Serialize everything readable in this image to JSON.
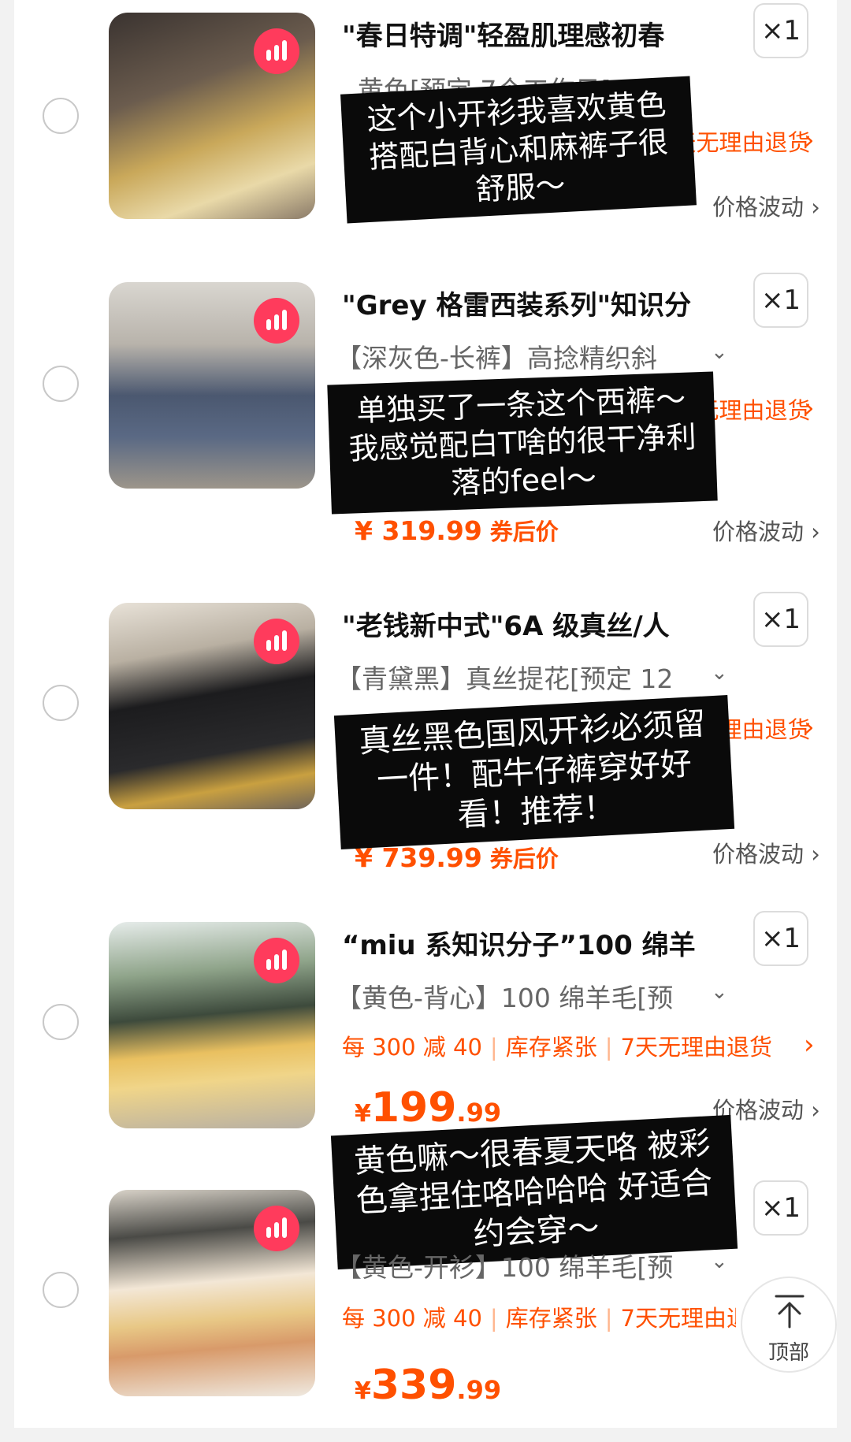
{
  "items": [
    {
      "title": "\"春日特调\"轻盈肌理感初春",
      "sku": "黄色[预定 7个工作日]:S...",
      "tags": [
        "",
        "",
        "7天无理由退货"
      ],
      "price": {
        "display": "",
        "label": ""
      },
      "fluct": "价格波动",
      "qty": "×1",
      "caption": "这个小开衫我喜欢黄色 搭配白背心和麻裤子很舒服～"
    },
    {
      "title": "\"Grey 格雷西装系列\"知识分",
      "sku": "【深灰色-长裤】高捻精织斜",
      "tags": [
        "",
        "",
        "7天无理由退货"
      ],
      "price": {
        "display": "¥ 319.99",
        "label": "券后价"
      },
      "fluct": "价格波动",
      "qty": "×1",
      "caption": "单独买了一条这个西裤～我感觉配白T啥的很干净利落的feel～"
    },
    {
      "title": "\"老钱新中式\"6A 级真丝/人",
      "sku": "【青黛黑】真丝提花[预定 12",
      "tags": [
        "",
        "",
        "7天无理由退货"
      ],
      "price": {
        "display": "¥ 739.99",
        "label": "券后价"
      },
      "fluct": "价格波动",
      "qty": "×1",
      "caption": "真丝黑色国风开衫必须留一件！配牛仔裤穿好好看！推荐！"
    },
    {
      "title": "“miu 系知识分子”100 绵羊",
      "sku": "【黄色-背心】100 绵羊毛[预",
      "tags": [
        "每 300 减 40",
        "库存紧张",
        "7天无理由退货"
      ],
      "price": {
        "yen": "¥",
        "int": "199",
        "dec": ".99"
      },
      "fluct": "价格波动",
      "qty": "×1",
      "caption": "黄色嘛～很春夏天咯 被彩色拿捏住咯哈哈哈 好适合约会穿～"
    },
    {
      "title": "",
      "sku": "【黄色-开衫】100 绵羊毛[预",
      "tags": [
        "每 300 减 40",
        "库存紧张",
        "7天无理由退货"
      ],
      "price": {
        "yen": "¥",
        "int": "339",
        "dec": ".99"
      },
      "fluct": "",
      "qty": "×1",
      "caption": ""
    }
  ],
  "scroll_top": {
    "label": "顶部"
  },
  "colors": {
    "accent": "#ff5000",
    "badge": "#ff3b5c",
    "caption_bg": "#0a0a0a"
  },
  "icons": {
    "badge": "chart-bars-icon",
    "chevron": "chevron-down-icon",
    "arrow": "chevron-right-icon",
    "totop": "arrow-up-to-top-icon"
  }
}
